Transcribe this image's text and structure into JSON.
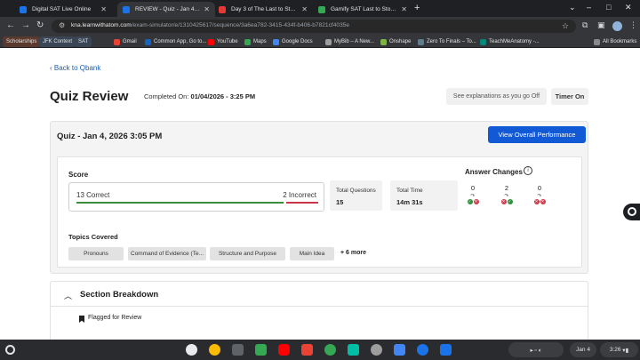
{
  "tabs": [
    {
      "label": "Digital SAT Live Online",
      "favicon_color": "#1a73e8"
    },
    {
      "label": "REVIEW - Quiz - Jan 4, 2026 3:0",
      "favicon_color": "#1a73e8"
    },
    {
      "label": "Day 3 of The Last to Stop Studi",
      "favicon_color": "#e53935"
    },
    {
      "label": "Gamify SAT Last to Stop Study!",
      "favicon_color": "#34a853"
    }
  ],
  "address_bar": {
    "host": "kna.learnwithatom.com",
    "path": "/exam-simulator/e/1310425617/sequence/3a6ea782-3415-434f-b406-b7821cf4035e"
  },
  "bookmarks": [
    "Scholarships",
    "JFK Context",
    "SAT",
    "Gmail",
    "Common App, Go to...",
    "YouTube",
    "Maps",
    "Google Docs",
    "MyBib – A New...",
    "Onshape",
    "Zero To Finals – To...",
    "TeachMeAnatomy -...",
    "All Bookmarks"
  ],
  "page": {
    "back_link": "Back to Qbank",
    "title": "Quiz Review",
    "completed_label": "Completed On:",
    "completed_value": "01/04/2026 - 3:25 PM",
    "explanations_button": "See explanations as you go Off",
    "timer_button": "Timer On",
    "quiz_name": "Quiz - Jan 4, 2026 3:05 PM",
    "overall_button": "View Overall Performance"
  },
  "score": {
    "label": "Score",
    "correct_text": "13 Correct",
    "incorrect_text": "2 Incorrect",
    "correct_count": 13,
    "incorrect_count": 2,
    "correct_color": "#3d8b3d",
    "incorrect_color": "#c9364a"
  },
  "stats": {
    "total_questions_label": "Total Questions",
    "total_questions_value": "15",
    "total_time_label": "Total Time",
    "total_time_value": "14m 31s"
  },
  "answer_changes": {
    "label": "Answer Changes",
    "columns": [
      {
        "count": "0",
        "from": "correct",
        "to": "incorrect"
      },
      {
        "count": "2",
        "from": "incorrect",
        "to": "correct"
      },
      {
        "count": "0",
        "from": "incorrect",
        "to": "incorrect"
      }
    ]
  },
  "topics": {
    "label": "Topics Covered",
    "items": [
      "Pronouns",
      "Command of Evidence (Te...",
      "Structure and Purpose",
      "Main Idea"
    ],
    "more": "+ 6 more"
  },
  "section_breakdown": {
    "title": "Section Breakdown",
    "flagged_label": "Flagged for Review"
  },
  "shelf": {
    "date": "Jan 4",
    "time": "3:26"
  }
}
